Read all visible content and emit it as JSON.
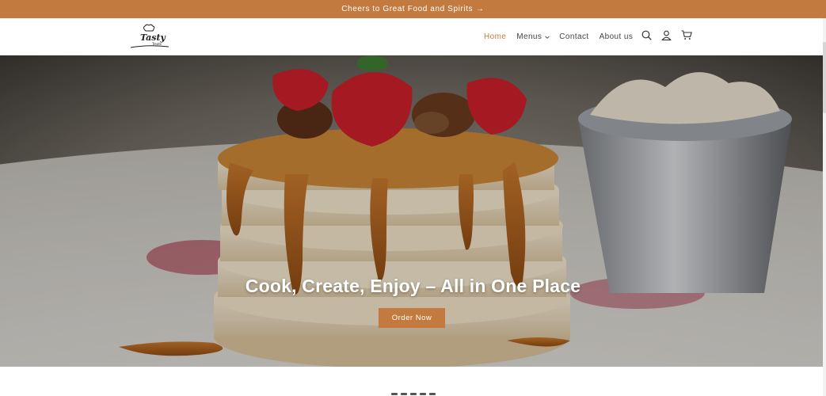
{
  "announcement": {
    "text": "Cheers to Great Food and Spirits",
    "arrow": "→"
  },
  "brand": {
    "name": "Tasty",
    "tagline": "Treats"
  },
  "nav": {
    "items": [
      {
        "label": "Home",
        "active": true
      },
      {
        "label": "Menus",
        "has_dropdown": true
      },
      {
        "label": "Contact"
      },
      {
        "label": "About us"
      }
    ]
  },
  "header_icons": [
    "search-icon",
    "account-icon",
    "cart-icon"
  ],
  "hero": {
    "title": "Cook, Create, Enjoy – All in One Place",
    "button_label": "Order Now",
    "image": "pancake stack with strawberries and caramel sauce, cream in metal cup"
  },
  "colors": {
    "accent": "#c27a3e",
    "header_bg": "#ffffff",
    "nav_text": "#444444"
  }
}
